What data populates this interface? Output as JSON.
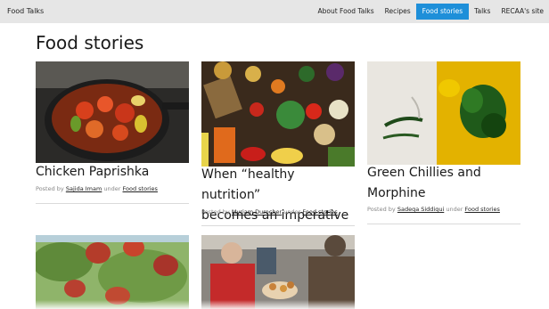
{
  "site": {
    "brand": "Food Talks"
  },
  "nav": {
    "items": [
      {
        "label": "About Food Talks"
      },
      {
        "label": "Recipes"
      },
      {
        "label": "Food stories"
      },
      {
        "label": "Talks"
      },
      {
        "label": "RECAA's site"
      }
    ],
    "active_label": "Food stories"
  },
  "page": {
    "title": "Food stories"
  },
  "meta_words": {
    "posted_by": "Posted by",
    "under": "under"
  },
  "posts": [
    {
      "title": "Chicken Paprishka",
      "author": "Sajida Imam",
      "category": "Food stories",
      "image": "chicken-paprika-pan-photo"
    },
    {
      "title_line1": "When “healthy nutrition”",
      "title_line2": "becomes an imperative",
      "author": "Myriam Durocher",
      "category": "Food stories",
      "image": "vegetables-spread-photo"
    },
    {
      "title_line1": "Green Chillies and",
      "title_line2": "Morphine",
      "author": "Sadeqa Siddiqui",
      "category": "Food stories",
      "image": "green-chillies-photo"
    },
    {
      "image": "red-berries-tree-photo"
    },
    {
      "image": "people-sharing-food-photo"
    }
  ],
  "colors": {
    "nav_active": "#1e8fd9",
    "topbar": "#e6e6e6"
  }
}
